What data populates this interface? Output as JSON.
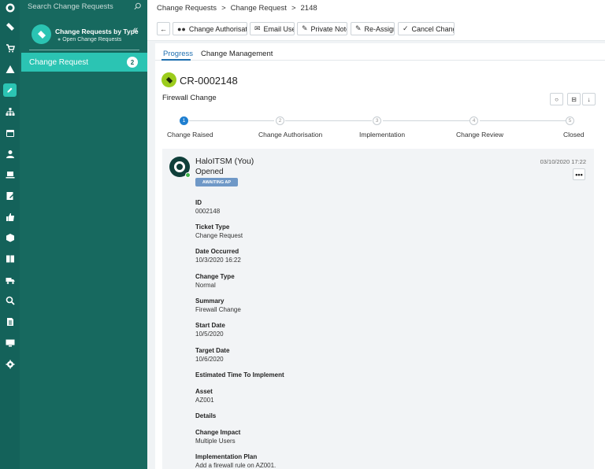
{
  "rail": {
    "items": [
      {
        "name": "halo-logo-icon"
      },
      {
        "name": "ticket-icon"
      },
      {
        "name": "cart-icon"
      },
      {
        "name": "warning-icon"
      },
      {
        "name": "edit-icon"
      },
      {
        "name": "org-chart-icon"
      },
      {
        "name": "calendar-icon"
      },
      {
        "name": "user-icon"
      },
      {
        "name": "laptop-icon"
      },
      {
        "name": "note-icon"
      },
      {
        "name": "thumbs-up-icon"
      },
      {
        "name": "box-icon"
      },
      {
        "name": "book-icon"
      },
      {
        "name": "truck-icon"
      },
      {
        "name": "search-icon"
      },
      {
        "name": "document-icon"
      },
      {
        "name": "monitor-icon"
      },
      {
        "name": "settings-icon"
      }
    ]
  },
  "panel": {
    "search_placeholder": "Search Change Requests",
    "group_title": "Change Requests by Type",
    "group_sub": "Open Change Requests",
    "category": {
      "label": "Change Request",
      "count": "2"
    }
  },
  "breadcrumb": {
    "items": [
      "Change Requests",
      ">",
      "Change Request",
      ">",
      "2148"
    ]
  },
  "toolbar": {
    "change_auth": "Change Authorisati...",
    "email_user": "Email User",
    "private_note": "Private Note",
    "reassign": "Re-Assign",
    "cancel_change": "Cancel Change"
  },
  "tabs": {
    "progress": "Progress",
    "change_management": "Change Management"
  },
  "ticket": {
    "id": "CR-0002148",
    "summary": "Firewall Change"
  },
  "stepper": {
    "steps": [
      {
        "num": "1",
        "label": "Change Raised"
      },
      {
        "num": "2",
        "label": "Change Authorisation"
      },
      {
        "num": "3",
        "label": "Implementation"
      },
      {
        "num": "4",
        "label": "Change Review"
      },
      {
        "num": "5",
        "label": "Closed"
      }
    ],
    "active_step": 1
  },
  "entry": {
    "who": "HaloITSM (You)",
    "status": "Opened",
    "badge": "AWAITING AP",
    "date": "03/10/2020 17:22",
    "more": "•••",
    "fields": [
      {
        "label": "ID",
        "value": "0002148"
      },
      {
        "label": "Ticket Type",
        "value": "Change Request"
      },
      {
        "label": "Date Occurred",
        "value": "10/3/2020 16:22"
      },
      {
        "label": "Change Type",
        "value": "Normal"
      },
      {
        "label": "Summary",
        "value": "Firewall Change"
      },
      {
        "label": "Start Date",
        "value": "10/5/2020"
      },
      {
        "label": "Target Date",
        "value": "10/6/2020"
      },
      {
        "label": "Estimated Time To Implement",
        "value": ""
      },
      {
        "label": "Asset",
        "value": "AZ001"
      },
      {
        "label": "Details",
        "value": ""
      },
      {
        "label": "Change Impact",
        "value": "Multiple Users"
      },
      {
        "label": "Implementation Plan",
        "value": "Add a firewall rule on AZ001."
      }
    ]
  },
  "colors": {
    "rail": "#14625a",
    "panel": "#17695f",
    "accent": "#2bc4b3",
    "link": "#1f6fb0"
  }
}
